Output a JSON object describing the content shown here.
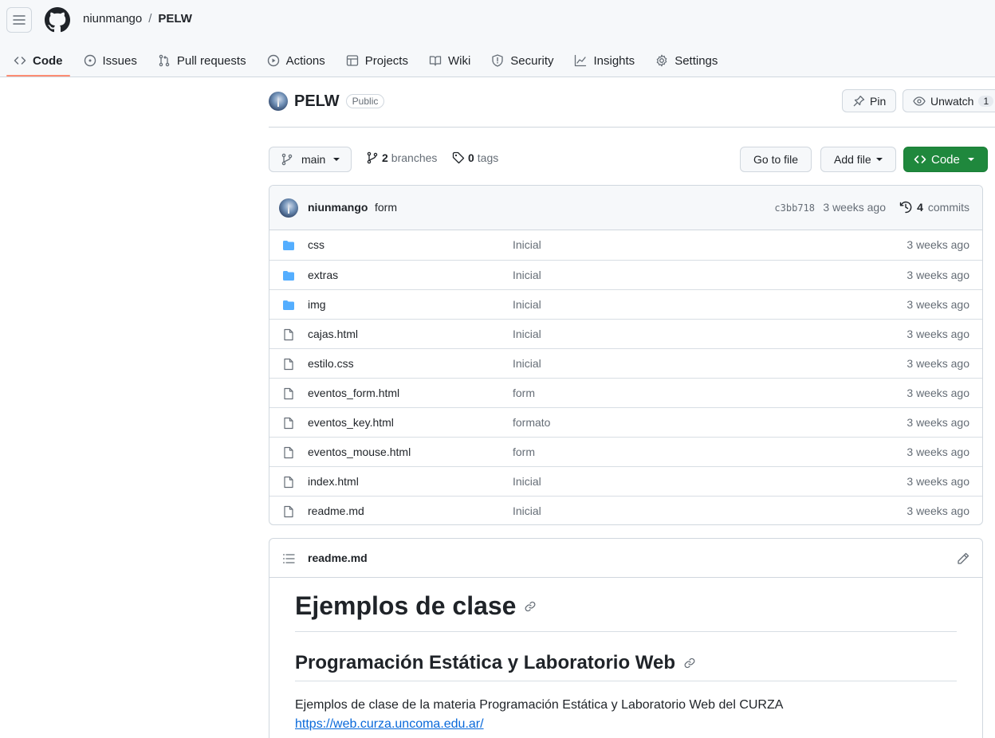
{
  "header": {
    "owner": "niunmango",
    "separator": "/",
    "repo": "PELW"
  },
  "tabs": [
    {
      "label": "Code",
      "icon": "code-icon",
      "active": true
    },
    {
      "label": "Issues",
      "icon": "issue-opened-icon"
    },
    {
      "label": "Pull requests",
      "icon": "git-pull-request-icon"
    },
    {
      "label": "Actions",
      "icon": "play-icon"
    },
    {
      "label": "Projects",
      "icon": "table-icon"
    },
    {
      "label": "Wiki",
      "icon": "book-icon"
    },
    {
      "label": "Security",
      "icon": "shield-icon"
    },
    {
      "label": "Insights",
      "icon": "graph-icon"
    },
    {
      "label": "Settings",
      "icon": "gear-icon"
    }
  ],
  "repo": {
    "name": "PELW",
    "visibility": "Public",
    "pin_label": "Pin",
    "unwatch_label": "Unwatch",
    "watch_count": "1"
  },
  "toolbar": {
    "branch": "main",
    "branches_count": "2",
    "branches_label": "branches",
    "tags_count": "0",
    "tags_label": "tags",
    "go_to_file": "Go to file",
    "add_file": "Add file",
    "code": "Code"
  },
  "latest_commit": {
    "author": "niunmango",
    "message": "form",
    "sha": "c3bb718",
    "when": "3 weeks ago",
    "commits_count": "4",
    "commits_label": "commits"
  },
  "files": [
    {
      "name": "css",
      "type": "dir",
      "message": "Inicial",
      "age": "3 weeks ago"
    },
    {
      "name": "extras",
      "type": "dir",
      "message": "Inicial",
      "age": "3 weeks ago"
    },
    {
      "name": "img",
      "type": "dir",
      "message": "Inicial",
      "age": "3 weeks ago"
    },
    {
      "name": "cajas.html",
      "type": "file",
      "message": "Inicial",
      "age": "3 weeks ago"
    },
    {
      "name": "estilo.css",
      "type": "file",
      "message": "Inicial",
      "age": "3 weeks ago"
    },
    {
      "name": "eventos_form.html",
      "type": "file",
      "message": "form",
      "age": "3 weeks ago"
    },
    {
      "name": "eventos_key.html",
      "type": "file",
      "message": "formato",
      "age": "3 weeks ago"
    },
    {
      "name": "eventos_mouse.html",
      "type": "file",
      "message": "form",
      "age": "3 weeks ago"
    },
    {
      "name": "index.html",
      "type": "file",
      "message": "Inicial",
      "age": "3 weeks ago"
    },
    {
      "name": "readme.md",
      "type": "file",
      "message": "Inicial",
      "age": "3 weeks ago"
    }
  ],
  "readme": {
    "filename": "readme.md",
    "h1": "Ejemplos de clase",
    "h2": "Programación Estática y Laboratorio Web",
    "paragraph": "Ejemplos de clase de la materia Programación Estática y Laboratorio Web del CURZA",
    "link": "https://web.curza.uncoma.edu.ar/"
  },
  "colors": {
    "accent_tab": "#fd8c73",
    "primary_green": "#1f883d",
    "folder_blue": "#54aeff",
    "link_blue": "#0969da"
  }
}
